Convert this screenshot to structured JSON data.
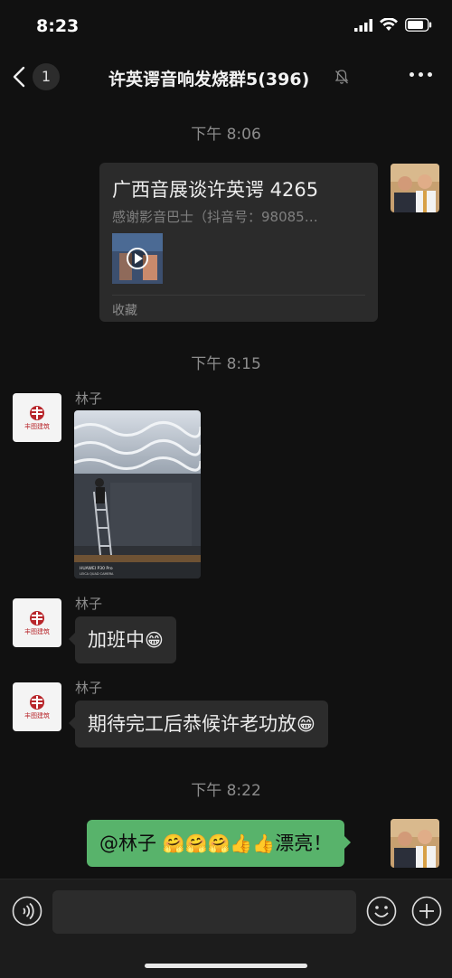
{
  "status_bar": {
    "time": "8:23"
  },
  "header": {
    "unread_count": "1",
    "title": "许英谔音响发烧群5(396)"
  },
  "messages": {
    "ts1": "下午 8:06",
    "card": {
      "title": "广西音展谈许英谔 4265",
      "description": "感谢影音巴士（抖音号：98085…",
      "footer": "收藏"
    },
    "ts2": "下午 8:15",
    "photo": {
      "sender": "林子",
      "watermark_line1": "HUAWEI P30 Pro",
      "watermark_line2": "LEICA QUAD CAMERA"
    },
    "msg2": {
      "sender": "林子",
      "text": "加班中",
      "emoji": "😁"
    },
    "msg3": {
      "sender": "林子",
      "text": "期待完工后恭候许老功放",
      "emoji": "😁"
    },
    "ts3": "下午 8:22",
    "msg4": {
      "mention": "@林子",
      "emojis": "🤗🤗🤗👍👍",
      "text": "漂亮！"
    }
  },
  "company_logo_text": "丰图建筑",
  "colors": {
    "background": "#111111",
    "self_bubble": "#58b36b",
    "other_bubble": "#2c2c2c",
    "logo_red": "#b8262b"
  },
  "icons": {
    "back": "chevron-left-icon",
    "mute": "bell-muted-icon",
    "more": "more-dots-icon",
    "voice": "voice-icon",
    "emoji": "emoji-icon",
    "plus": "plus-icon"
  }
}
